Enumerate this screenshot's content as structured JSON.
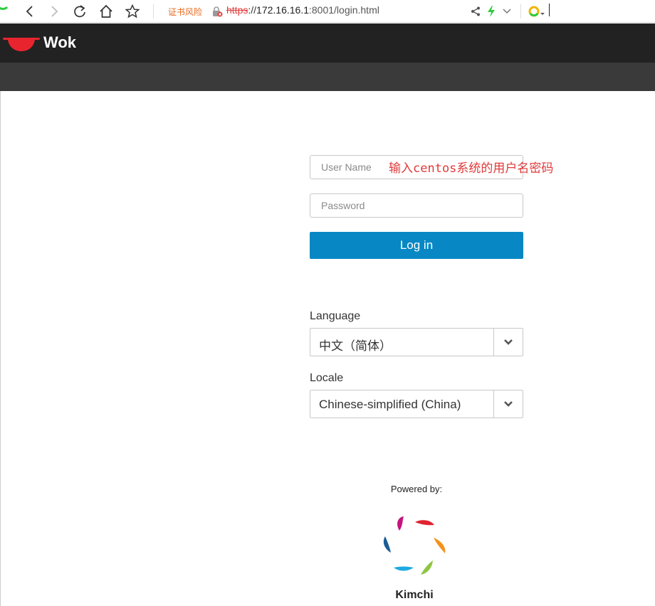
{
  "browser": {
    "cert_warning": "证书风险",
    "url_scheme": "https",
    "url_separator": "://",
    "url_host": "172.16.16.1",
    "url_rest": ":8001/login.html",
    "icons": [
      "back-icon",
      "forward-icon",
      "reload-icon",
      "home-icon",
      "star-icon",
      "lock-warning-icon",
      "share-icon",
      "lightning-icon",
      "chevron-down-icon",
      "search-engine-icon"
    ]
  },
  "header": {
    "brand": "Wok",
    "logo_icon": "wok-logo-icon",
    "colors": {
      "header_bg": "#222222",
      "subheader_bg": "#3a3a3a",
      "logo_red": "#e8252e"
    }
  },
  "login": {
    "username_placeholder": "User Name",
    "password_placeholder": "Password",
    "annotation": "输入centos系统的用户名密码",
    "login_label": "Log in",
    "button_color": "#0788c4"
  },
  "language": {
    "label": "Language",
    "selected": "中文（简体）"
  },
  "locale": {
    "label": "Locale",
    "selected": "Chinese-simplified (China)"
  },
  "footer": {
    "powered_by": "Powered by:",
    "product": "Kimchi",
    "logo_icon": "kimchi-logo-icon"
  }
}
